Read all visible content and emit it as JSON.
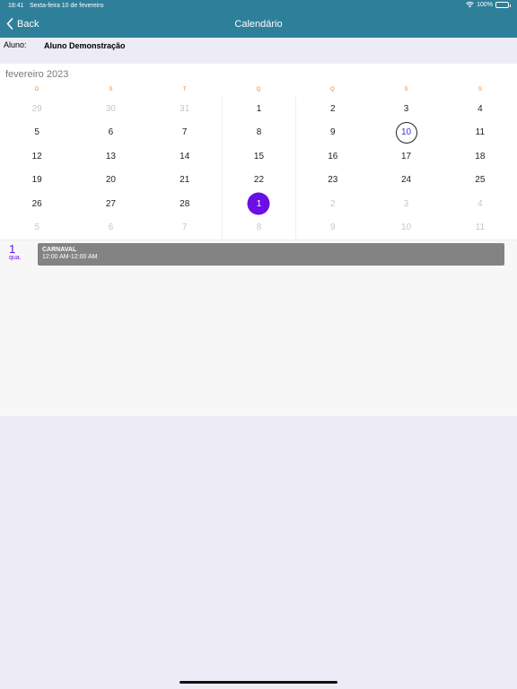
{
  "status_bar": {
    "time": "18:41",
    "date": "Sexta-feira 10 de fevereiro",
    "battery": "100%"
  },
  "nav": {
    "back_label": "Back",
    "title": "Calendário"
  },
  "aluno": {
    "label": "Aluno:",
    "value": "Aluno Demonstração"
  },
  "calendar": {
    "month": "fevereiro 2023",
    "weekdays": [
      "D",
      "S",
      "T",
      "Q",
      "Q",
      "S",
      "S"
    ],
    "weeks": [
      [
        "29",
        "30",
        "31",
        "1",
        "2",
        "3",
        "4"
      ],
      [
        "5",
        "6",
        "7",
        "8",
        "9",
        "10",
        "11"
      ],
      [
        "12",
        "13",
        "14",
        "15",
        "16",
        "17",
        "18"
      ],
      [
        "19",
        "20",
        "21",
        "22",
        "23",
        "24",
        "25"
      ],
      [
        "26",
        "27",
        "28",
        "1",
        "2",
        "3",
        "4"
      ],
      [
        "5",
        "6",
        "7",
        "8",
        "9",
        "10",
        "11"
      ]
    ],
    "today": "10",
    "selected": "1"
  },
  "events": {
    "day": "1",
    "weekday": "qua.",
    "items": [
      {
        "title": "CARNAVAL",
        "time": "12:00 AM-12:00 AM"
      }
    ]
  },
  "colors": {
    "nav_bar": "#2e7f99",
    "accent": "#6a0fe6",
    "weekday_header": "#e8822e",
    "event_card": "#838383"
  }
}
